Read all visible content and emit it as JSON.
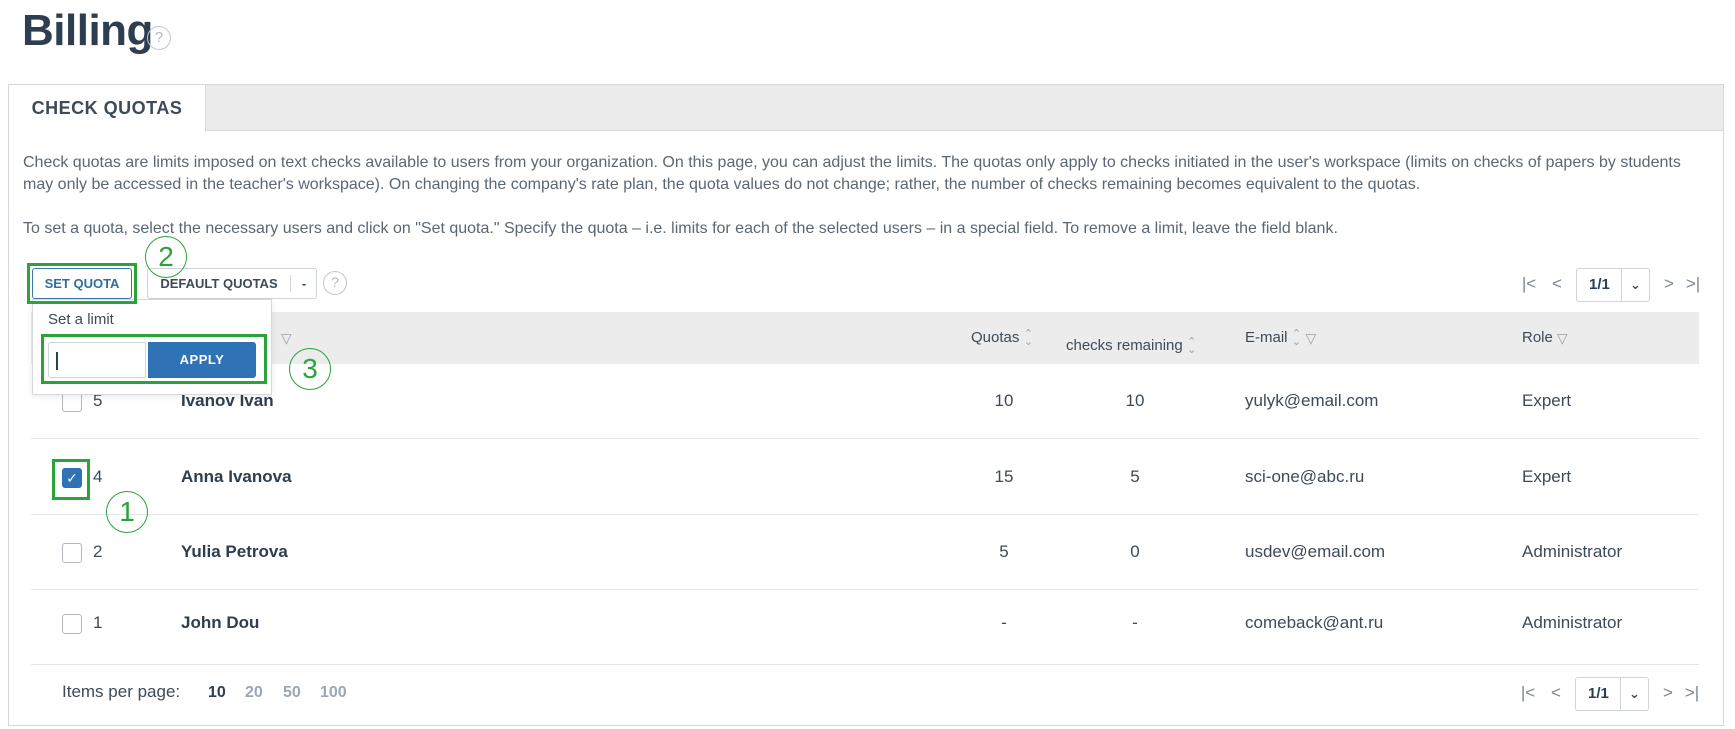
{
  "page": {
    "title": "Billing",
    "help_glyph": "?"
  },
  "tabs": [
    {
      "label": "CHECK QUOTAS",
      "active": true
    }
  ],
  "description": {
    "paragraph1": "Check quotas are limits imposed on text checks available to users from your organization. On this page, you can adjust the limits. The quotas only apply to checks initiated in the user's workspace (limits on checks of papers by students may only be accessed in the teacher's workspace). On changing the company's rate plan, the quota values do not change; rather, the number of checks remaining becomes equivalent to the quotas.",
    "paragraph2": "To set a quota, select the necessary users and click on \"Set quota.\" Specify the quota – i.e. limits for each of the selected users – in a special field. To remove a limit, leave the field blank."
  },
  "toolbar": {
    "set_quota_label": "SET QUOTA",
    "default_quotas_label": "DEFAULT QUOTAS",
    "default_quotas_value": "-",
    "help_glyph": "?"
  },
  "set_limit_dropdown": {
    "label": "Set a limit",
    "input_value": "",
    "apply_label": "APPLY"
  },
  "pagination": {
    "page_display": "1/1",
    "first_glyph": "|<",
    "prev_glyph": "<",
    "next_glyph": ">",
    "last_glyph": ">|",
    "dropdown_glyph": "⌄"
  },
  "table": {
    "columns": {
      "quotas": "Quotas",
      "checks_remaining": "checks remaining",
      "email": "E-mail",
      "role": "Role"
    },
    "rows": [
      {
        "id": "5",
        "name": "Ivanov Ivan",
        "quotas": "10",
        "checks_remaining": "10",
        "email": "yulyk@email.com",
        "role": "Expert",
        "checked": false
      },
      {
        "id": "4",
        "name": "Anna Ivanova",
        "quotas": "15",
        "checks_remaining": "5",
        "email": "sci-one@abc.ru",
        "role": "Expert",
        "checked": true
      },
      {
        "id": "2",
        "name": "Yulia Petrova",
        "quotas": "5",
        "checks_remaining": "0",
        "email": "usdev@email.com",
        "role": "Administrator",
        "checked": false
      },
      {
        "id": "1",
        "name": "John Dou",
        "quotas": "-",
        "checks_remaining": "-",
        "email": "comeback@ant.ru",
        "role": "Administrator",
        "checked": false
      }
    ]
  },
  "items_per_page": {
    "label": "Items per page:",
    "options": [
      "10",
      "20",
      "50",
      "100"
    ],
    "selected": "10"
  },
  "annotations": {
    "step1": "1",
    "step2": "2",
    "step3": "3"
  },
  "colors": {
    "accent": "#2f72b5",
    "highlight": "#2aa33a",
    "header_bg": "#ececec"
  },
  "icons": [
    "help-icon",
    "sort-icon",
    "filter-icon",
    "checkmark-icon",
    "first-page-icon",
    "prev-page-icon",
    "next-page-icon",
    "last-page-icon",
    "chevron-down-icon"
  ]
}
